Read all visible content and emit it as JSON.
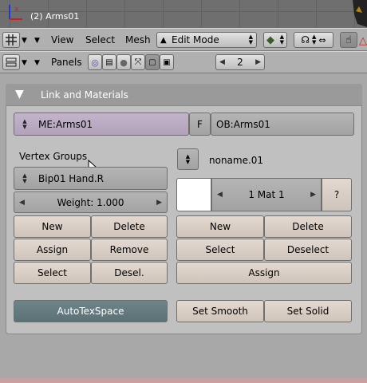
{
  "viewport": {
    "object_title": "(2) Arms01"
  },
  "header1": {
    "menus": [
      "View",
      "Select",
      "Mesh"
    ],
    "mode": "Edit Mode"
  },
  "header2": {
    "panels_label": "Panels",
    "frame_value": "2"
  },
  "panel": {
    "title": "Link and Materials",
    "mesh_name": "ME:Arms01",
    "fake_user_label": "F",
    "object_name": "OB:Arms01",
    "vertex_groups_label": "Vertex Groups",
    "vertex_group_name": "Bip01 Hand.R",
    "weight": "Weight: 1.000",
    "vg_buttons": {
      "new": "New",
      "delete": "Delete",
      "assign": "Assign",
      "remove": "Remove",
      "select": "Select",
      "deselect": "Desel."
    },
    "autotexspace": "AutoTexSpace",
    "uv_name": "noname.01",
    "material": "1 Mat 1",
    "material_help": "?",
    "mat_buttons": {
      "new": "New",
      "delete": "Delete",
      "select": "Select",
      "deselect": "Deselect",
      "assign": "Assign"
    },
    "set_smooth": "Set Smooth",
    "set_solid": "Set Solid"
  }
}
